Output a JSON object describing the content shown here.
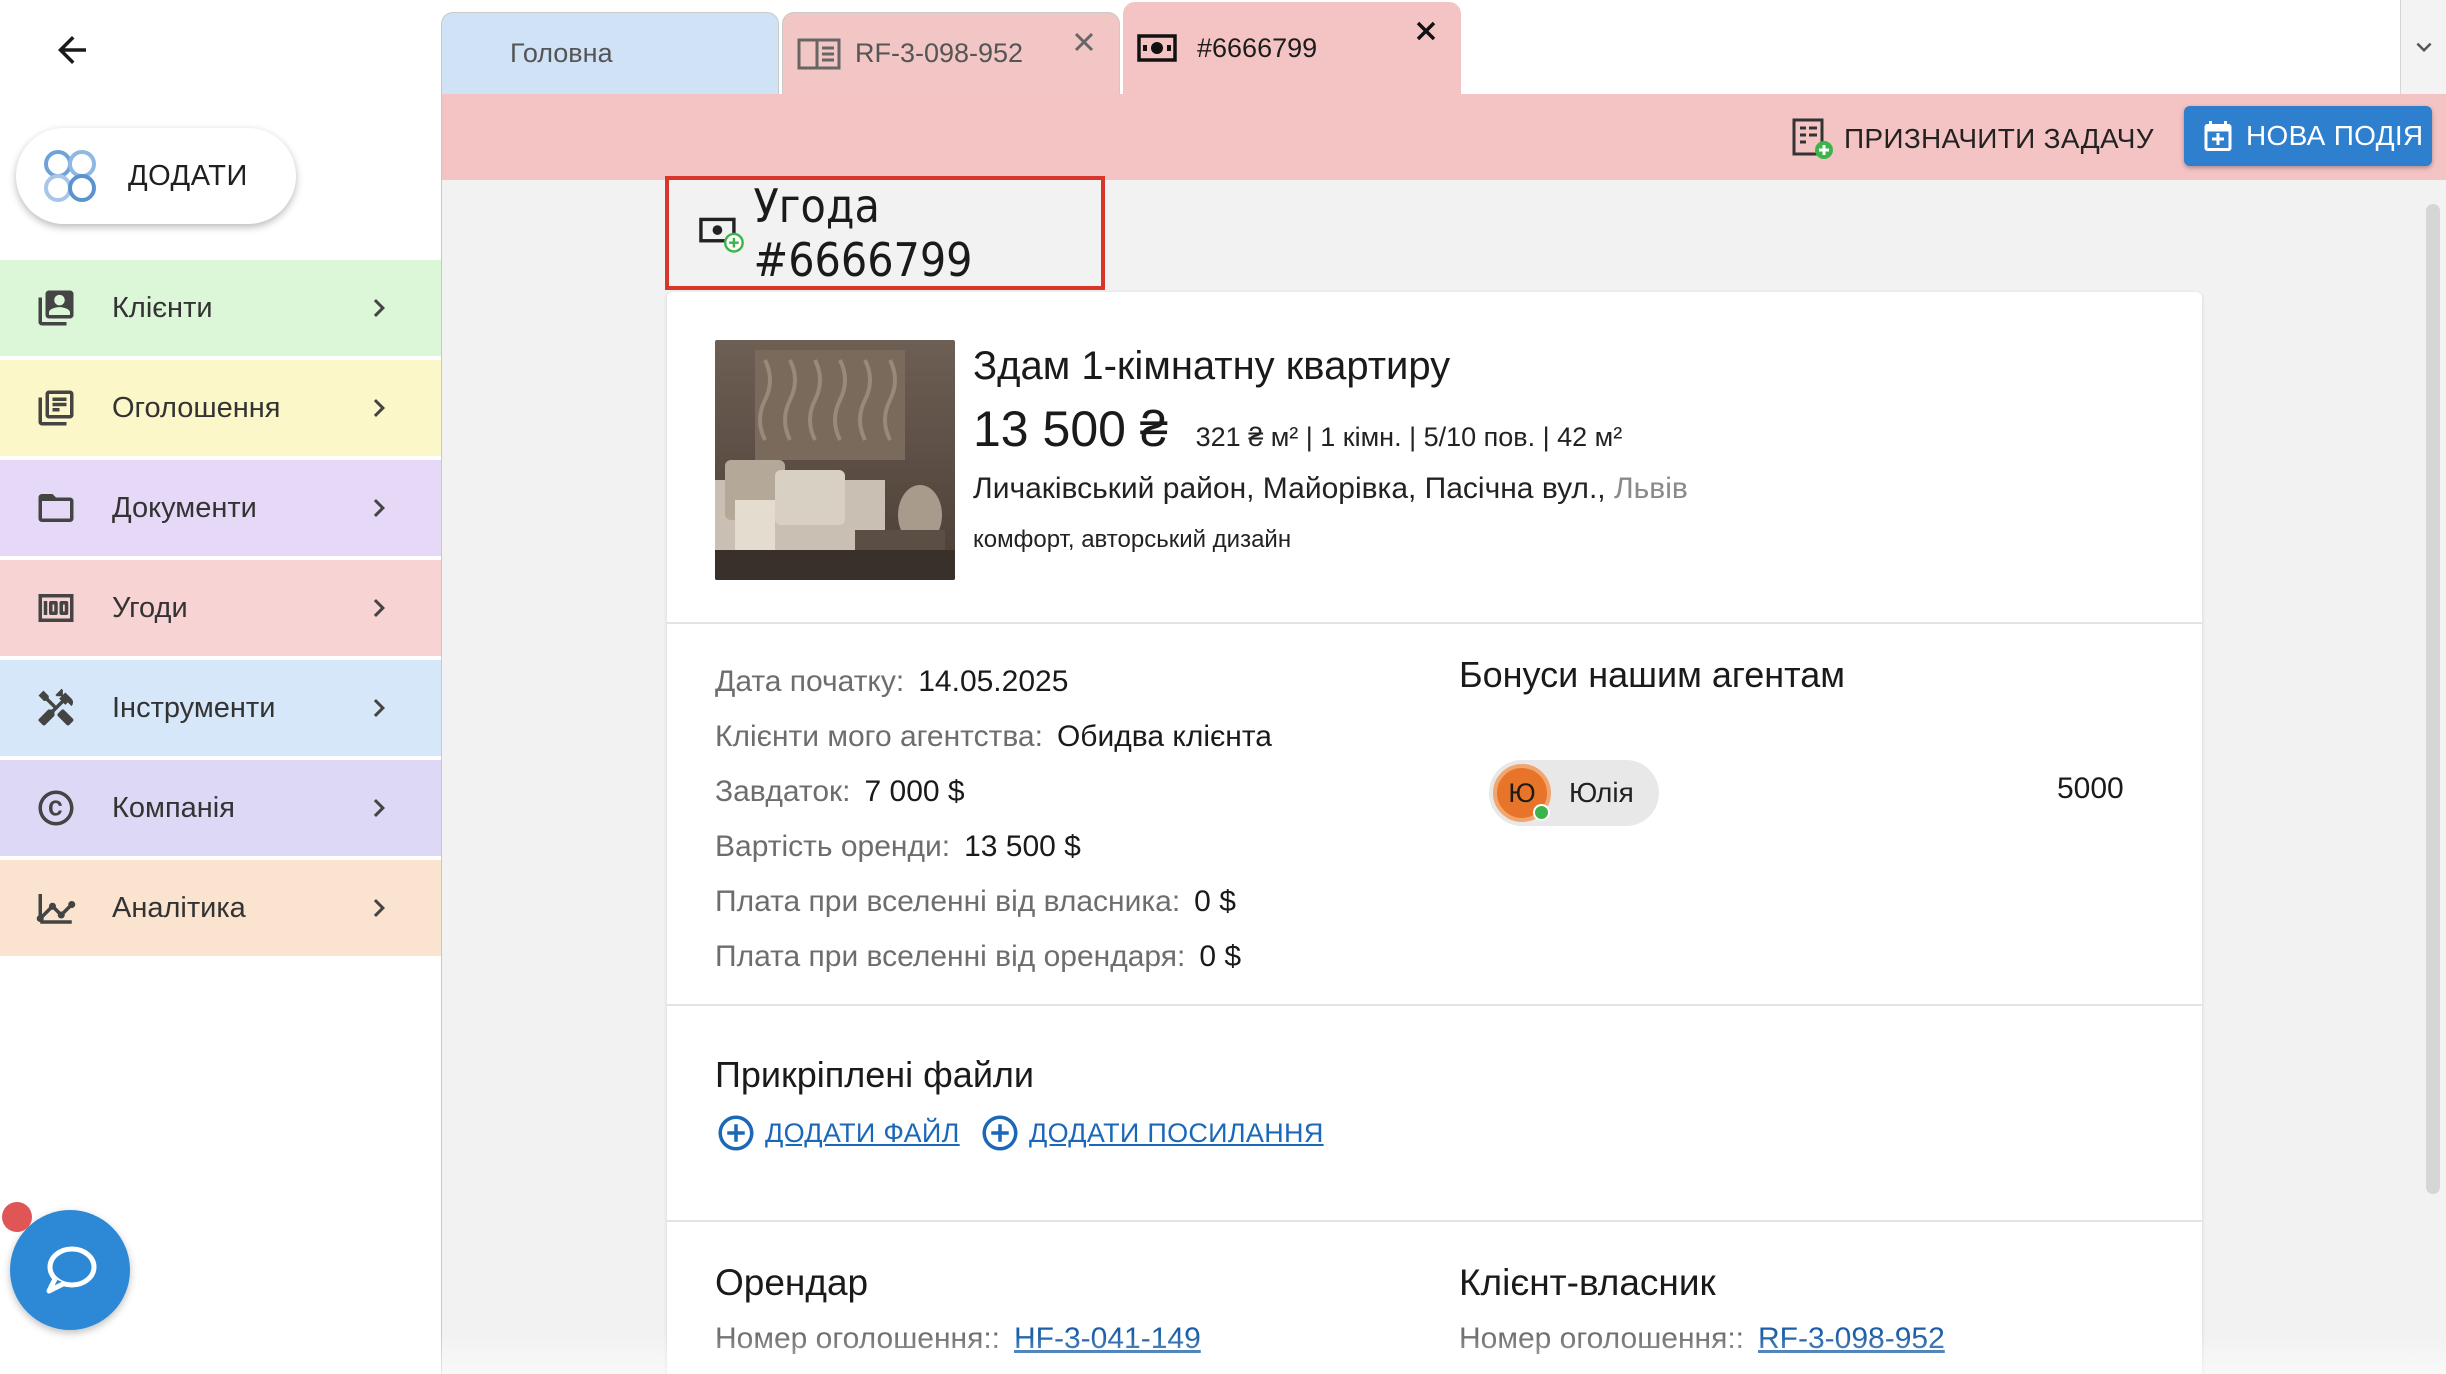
{
  "sidebar": {
    "add_label": "ДОДАТИ",
    "items": [
      {
        "label": "Клієнти",
        "icon": "contacts-icon",
        "color": "#dcf6d8"
      },
      {
        "label": "Оголошення",
        "icon": "listing-icon",
        "color": "#fbf7c8"
      },
      {
        "label": "Документи",
        "icon": "folder-icon",
        "color": "#e6d9f7"
      },
      {
        "label": "Угоди",
        "icon": "money-icon",
        "color": "#f8d3d3"
      },
      {
        "label": "Інструменти",
        "icon": "tools-icon",
        "color": "#d6e7f9"
      },
      {
        "label": "Компанія",
        "icon": "copyright-icon",
        "color": "#dcd8f5"
      },
      {
        "label": "Аналітика",
        "icon": "analytics-icon",
        "color": "#fae3cf"
      }
    ]
  },
  "tabs": [
    {
      "label": "Головна"
    },
    {
      "label": "RF-3-098-952"
    },
    {
      "label": "#6666799"
    }
  ],
  "actions": {
    "assign_task": "ПРИЗНАЧИТИ ЗАДАЧУ",
    "new_event": "НОВА ПОДІЯ"
  },
  "deal": {
    "title": "Угода #6666799",
    "property": {
      "title": "Здам 1-кімнатну квартиру",
      "price": "13 500 ₴",
      "meta": "321 ₴ м² | 1 кімн. | 5/10 пов. | 42 м²",
      "address": "Личаківський район, Майорівка, Пасічна вул.,",
      "city": "Львів",
      "description": "комфорт, авторський дизайн"
    },
    "info": [
      {
        "key": "Дата початку:",
        "value": "14.05.2025"
      },
      {
        "key": "Клієнти мого агентства:",
        "value": "Обидва клієнта"
      },
      {
        "key": "Завдаток:",
        "value": "7 000 $"
      },
      {
        "key": "Вартість оренди:",
        "value": "13 500 $"
      },
      {
        "key": "Плата при вселенні від власника:",
        "value": "0 $"
      },
      {
        "key": "Плата при вселенні від орендаря:",
        "value": "0 $"
      }
    ],
    "bonuses": {
      "title": "Бонуси нашим агентам",
      "agent_initial": "Ю",
      "agent_name": "Юлія",
      "amount": "5000"
    },
    "files": {
      "title": "Прикріплені файли",
      "add_file": "ДОДАТИ ФАЙЛ",
      "add_link": "ДОДАТИ ПОСИЛАННЯ"
    },
    "tenant": {
      "title": "Орендар",
      "ad_key": "Номер оголошення::",
      "ad_value": "HF-3-041-149"
    },
    "owner": {
      "title": "Клієнт-власник",
      "ad_key": "Номер оголошення::",
      "ad_value": "RF-3-098-952"
    }
  }
}
